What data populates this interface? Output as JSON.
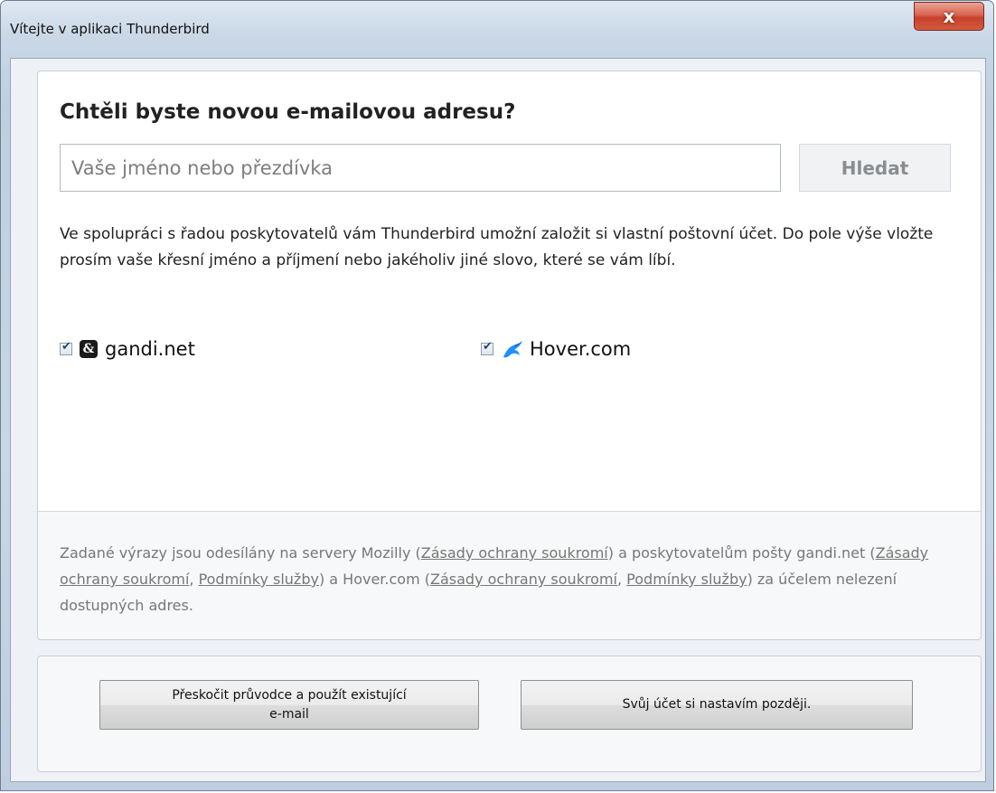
{
  "window": {
    "title": "Vítejte v aplikaci Thunderbird",
    "close_label": "x"
  },
  "main": {
    "heading": "Chtěli byste novou e-mailovou adresu?",
    "search": {
      "placeholder": "Vaše jméno nebo přezdívka",
      "value": "",
      "button_label": "Hledat"
    },
    "description": "Ve spolupráci s řadou poskytovatelů vám Thunderbird umožní založit si vlastní poštovní účet. Do pole výše vložte prosím vaše křesní jméno a příjmení nebo jakéholiv jiné slovo, které se vám líbí.",
    "providers": [
      {
        "name": "gandi.net",
        "checked": true,
        "icon": "gandi-icon"
      },
      {
        "name": "Hover.com",
        "checked": true,
        "icon": "hover-icon"
      }
    ]
  },
  "privacy": {
    "t1": "Zadané výrazy jsou odesílány na servery Mozilly (",
    "link_mozilla_privacy": "Zásady ochrany soukromí",
    "t2": ") a poskytovatelům pošty gandi.net (",
    "link_gandi_privacy": "Zásady ochrany soukromí",
    "t3": ", ",
    "link_gandi_terms": "Podmínky služby",
    "t4": ") a Hover.com (",
    "link_hover_privacy": "Zásady ochrany soukromí",
    "t5": ", ",
    "link_hover_terms": "Podmínky služby",
    "t6": ") za účelem nelezení dostupných adres."
  },
  "footer": {
    "skip_label_line1": "Přeskočit průvodce a použít existující",
    "skip_label_line2": "e-mail",
    "later_label": "Svůj účet si nastavím později."
  },
  "colors": {
    "close_button": "#c8402a",
    "hover_brand": "#1e90ff"
  }
}
